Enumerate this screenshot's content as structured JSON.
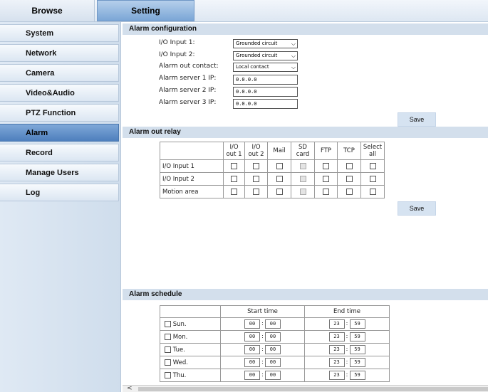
{
  "tabs": {
    "browse": "Browse",
    "setting": "Setting"
  },
  "sidebar": {
    "items": [
      {
        "label": "System"
      },
      {
        "label": "Network"
      },
      {
        "label": "Camera"
      },
      {
        "label": "Video&Audio"
      },
      {
        "label": "PTZ Function"
      },
      {
        "label": "Alarm",
        "active": true
      },
      {
        "label": "Record"
      },
      {
        "label": "Manage Users"
      },
      {
        "label": "Log"
      }
    ]
  },
  "alarm_config": {
    "title": "Alarm configuration",
    "io_input1_label": "I/O Input 1:",
    "io_input1_value": "Grounded circuit",
    "io_input2_label": "I/O Input 2:",
    "io_input2_value": "Grounded circuit",
    "alarm_out_label": "Alarm out contact:",
    "alarm_out_value": "Local contact",
    "server1_label": "Alarm server 1 IP:",
    "server1_value": "0.0.0.0",
    "server2_label": "Alarm server 2 IP:",
    "server2_value": "0.0.0.0",
    "server3_label": "Alarm server 3 IP:",
    "server3_value": "0.0.0.0",
    "save_label": "Save"
  },
  "relay": {
    "title": "Alarm out relay",
    "col_io1_a": "I/O",
    "col_io1_b": "out 1",
    "col_io2_a": "I/O",
    "col_io2_b": "out 2",
    "col_mail": "Mail",
    "col_sd_a": "SD",
    "col_sd_b": "card",
    "col_ftp": "FTP",
    "col_tcp": "TCP",
    "col_all_a": "Select",
    "col_all_b": "all",
    "rows": [
      "I/O Input 1",
      "I/O Input 2",
      "Motion area"
    ],
    "save_label": "Save"
  },
  "schedule": {
    "title": "Alarm schedule",
    "start_header": "Start time",
    "end_header": "End time",
    "days": [
      "Sun.",
      "Mon.",
      "Tue.",
      "Wed.",
      "Thu."
    ],
    "start_hour": "00",
    "start_min": "00",
    "end_hour": "23",
    "end_min": "59",
    "colon": ":"
  },
  "scrollbar": {
    "left_arrow": "<"
  }
}
